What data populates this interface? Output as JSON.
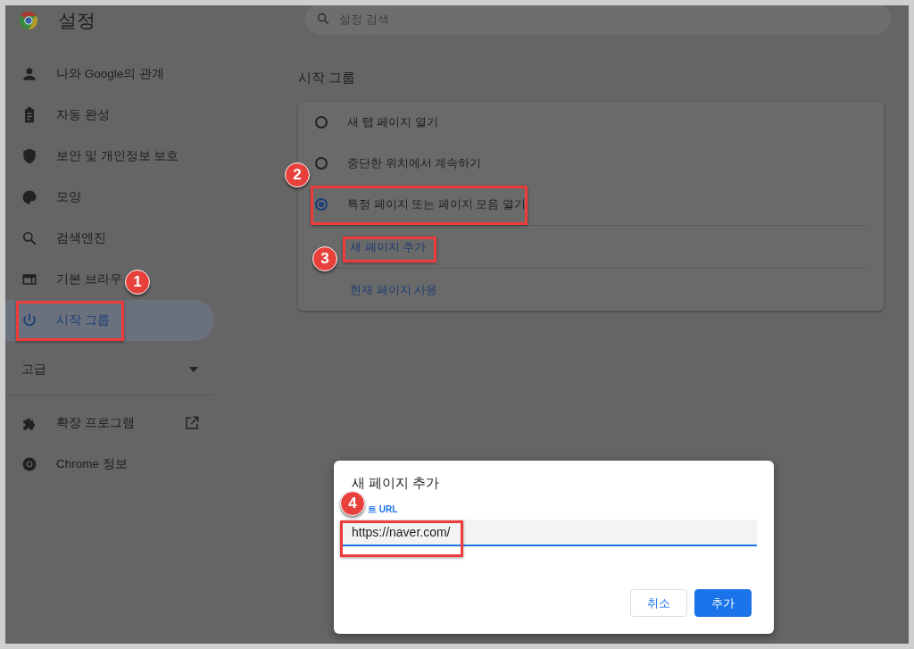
{
  "header": {
    "title": "설정",
    "search": {
      "placeholder": "설정 검색"
    }
  },
  "sidebar": {
    "items": [
      {
        "label": "나와 Google의 관계",
        "selected": false
      },
      {
        "label": "자동 완성",
        "selected": false
      },
      {
        "label": "보안 및 개인정보 보호",
        "selected": false
      },
      {
        "label": "모양",
        "selected": false
      },
      {
        "label": "검색엔진",
        "selected": false
      },
      {
        "label": "기본 브라우",
        "selected": false
      },
      {
        "label": "시작 그룹",
        "selected": true
      }
    ],
    "advanced": {
      "label": "고급",
      "expanded": false
    },
    "extra_items": [
      {
        "label": "확장 프로그램",
        "external": true
      },
      {
        "label": "Chrome 정보",
        "external": false
      }
    ]
  },
  "startup": {
    "title": "시작 그룹",
    "options": [
      {
        "label": "새 탭 페이지 열기",
        "selected": false
      },
      {
        "label": "중단한 위치에서 계속하기",
        "selected": false
      },
      {
        "label": "특정 페이지 또는 페이지 모음 열기",
        "selected": true
      }
    ],
    "links": [
      "새 페이지 추가",
      "현재 페이지 사용"
    ]
  },
  "dialog": {
    "title": "새 페이지 추가",
    "field": {
      "label": "트 URL",
      "value": "https://naver.com/"
    },
    "buttons": [
      {
        "label": "취소",
        "kind": "secondary"
      },
      {
        "label": "추가",
        "kind": "primary"
      }
    ]
  },
  "annotations": [
    {
      "number": "1"
    },
    {
      "number": "2"
    },
    {
      "number": "3"
    },
    {
      "number": "4"
    }
  ]
}
